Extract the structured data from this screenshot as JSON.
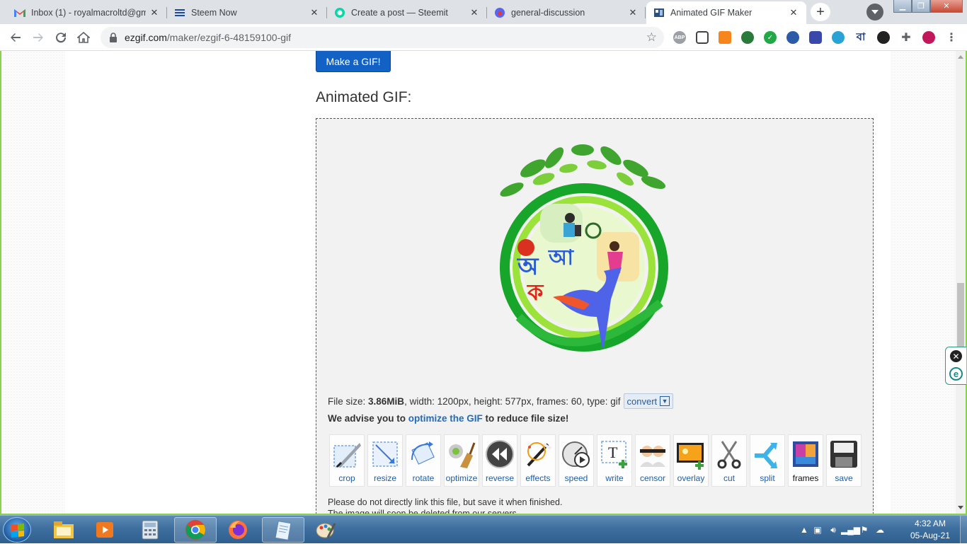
{
  "browser": {
    "tabs": [
      {
        "title": "Inbox (1) - royalmacroltd@gm",
        "icon": "gmail-icon",
        "active": false
      },
      {
        "title": "Steem Now",
        "icon": "steem-now-icon",
        "active": false
      },
      {
        "title": "Create a post — Steemit",
        "icon": "steemit-icon",
        "active": false
      },
      {
        "title": "general-discussion",
        "icon": "discord-icon",
        "active": false
      },
      {
        "title": "Animated GIF Maker",
        "icon": "ezgif-icon",
        "active": true
      }
    ],
    "url_host": "ezgif.com",
    "url_path": "/maker/ezgif-6-48159100-gif",
    "extensions": [
      "abp-icon",
      "qr-icon",
      "metamask-icon",
      "globe-icon",
      "check-icon",
      "accessibility-icon",
      "grid-icon",
      "steem-icon",
      "bangla-icon",
      "theme-icon",
      "puzzle-icon",
      "profile-icon"
    ],
    "ext_text": {
      "abp": "ABP",
      "bangla": "বা"
    }
  },
  "page": {
    "make_gif_label": "Make a GIF!",
    "section_title": "Animated GIF:",
    "file_info": {
      "prefix": "File size: ",
      "size": "3.86MiB",
      "details": ", width: 1200px, height: 577px, frames: 60, type: gif",
      "convert_label": "convert"
    },
    "advise": {
      "before": "We advise you to ",
      "link": "optimize the GIF",
      "after": " to reduce file size!"
    },
    "tools": [
      {
        "label": "crop",
        "icon": "crop-icon"
      },
      {
        "label": "resize",
        "icon": "resize-icon"
      },
      {
        "label": "rotate",
        "icon": "rotate-icon"
      },
      {
        "label": "optimize",
        "icon": "optimize-icon"
      },
      {
        "label": "reverse",
        "icon": "reverse-icon"
      },
      {
        "label": "effects",
        "icon": "effects-icon"
      },
      {
        "label": "speed",
        "icon": "speed-icon"
      },
      {
        "label": "write",
        "icon": "write-icon"
      },
      {
        "label": "censor",
        "icon": "censor-icon"
      },
      {
        "label": "overlay",
        "icon": "overlay-icon"
      },
      {
        "label": "cut",
        "icon": "cut-icon"
      },
      {
        "label": "split",
        "icon": "split-icon"
      },
      {
        "label": "frames",
        "icon": "frames-icon"
      },
      {
        "label": "save",
        "icon": "save-icon"
      }
    ],
    "note_line1": "Please do not directly link this file, but save it when finished.",
    "note_line2": "The image will soon be deleted from our servers."
  },
  "taskbar": {
    "pinned": [
      "explorer-icon",
      "media-player-icon",
      "calculator-icon",
      "chrome-icon",
      "firefox-icon",
      "notepad-icon",
      "paint-icon"
    ],
    "active_app": "chrome-icon",
    "time": "4:32 AM",
    "date": "05-Aug-21"
  },
  "colors": {
    "accent": "#1262c6",
    "link": "#1f6bbd",
    "window_border": "#8bd04e"
  }
}
